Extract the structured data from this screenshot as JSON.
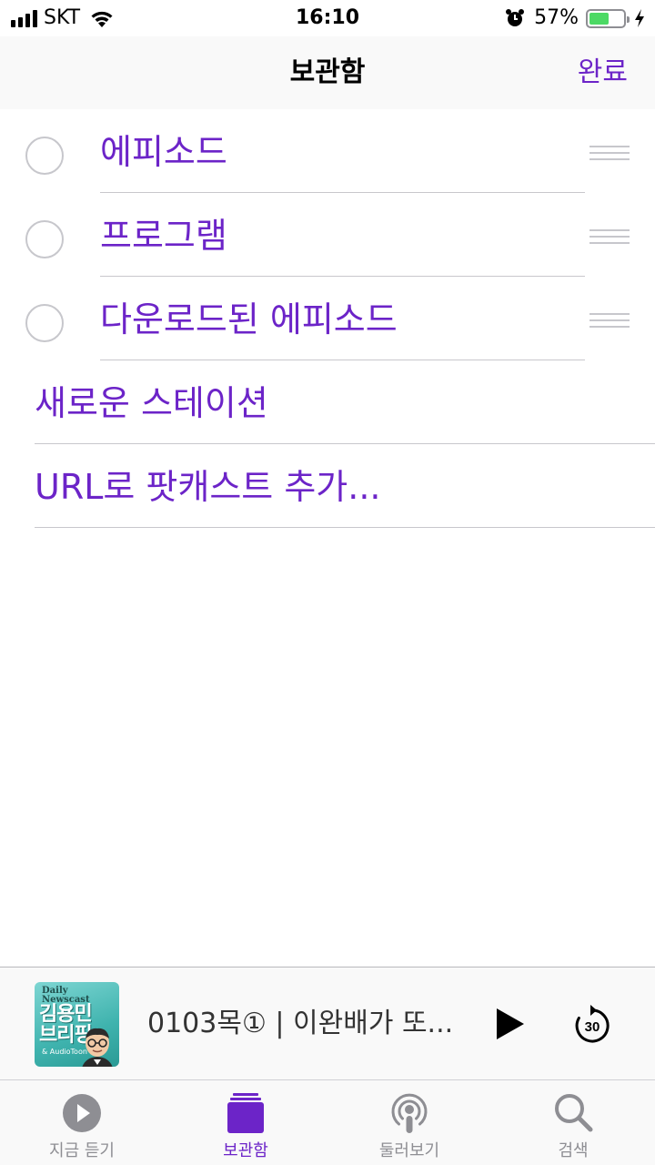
{
  "status_bar": {
    "carrier": "SKT",
    "time": "16:10",
    "battery_percent": "57%",
    "battery_level": 0.57,
    "signal_bars": 4,
    "charging": true
  },
  "nav": {
    "title": "보관함",
    "done_label": "완료"
  },
  "list": {
    "editable_items": [
      {
        "label": "에피소드",
        "checked": false
      },
      {
        "label": "프로그램",
        "checked": false
      },
      {
        "label": "다운로드된 에피소드",
        "checked": false
      }
    ],
    "actions": [
      {
        "label": "새로운 스테이션"
      },
      {
        "label": "URL로 팟캐스트 추가..."
      }
    ]
  },
  "mini_player": {
    "title": "0103목① | 이완배가 또...",
    "artwork": {
      "brand_line1": "Daily",
      "brand_line2": "Newscast",
      "title_line1": "김용민",
      "title_line2": "브리핑",
      "subtitle": "& AudioToon",
      "color": "#3fb3ae"
    },
    "skip_label": "30",
    "play_icon": "play-icon",
    "skip_icon": "skip-forward-30-icon"
  },
  "tab_bar": {
    "tabs": [
      {
        "label": "지금 듣기",
        "icon": "play-circle-icon",
        "active": false
      },
      {
        "label": "보관함",
        "icon": "library-icon",
        "active": true
      },
      {
        "label": "둘러보기",
        "icon": "podcast-icon",
        "active": false
      },
      {
        "label": "검색",
        "icon": "search-icon",
        "active": false
      }
    ]
  },
  "colors": {
    "accent": "#6c24c8",
    "inactive": "#8e8e93",
    "battery": "#4cd964"
  }
}
